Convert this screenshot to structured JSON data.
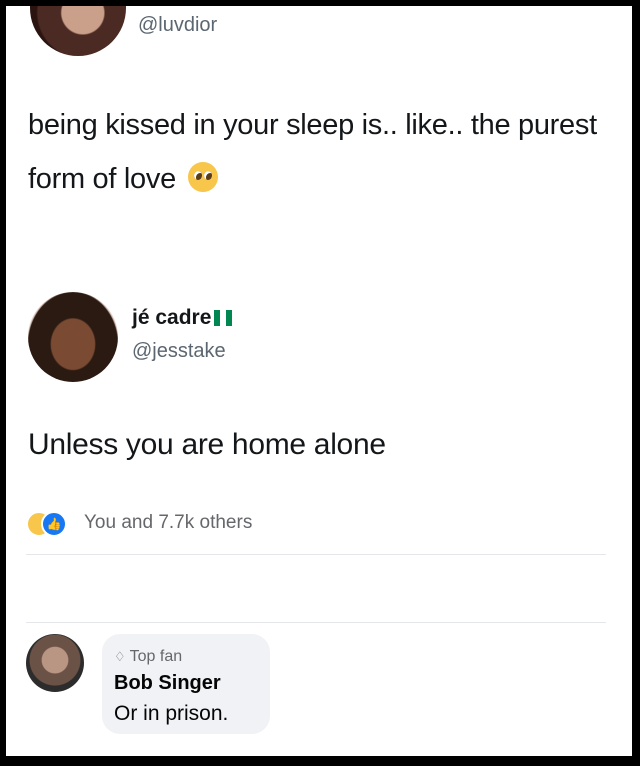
{
  "tweet_original": {
    "handle": "@luvdior",
    "text": "being kissed in your sleep is.. like.. the purest form of love",
    "emoji": "pleading-face-emoji"
  },
  "tweet_reply": {
    "display_name": "jé cadre",
    "flag": "nigeria-flag",
    "handle": "@jesstake",
    "text": "Unless you are home alone"
  },
  "reactions": {
    "icons": [
      "haha-reaction-icon",
      "like-reaction-icon"
    ],
    "summary": "You and 7.7k others"
  },
  "comment": {
    "badge": "Top fan",
    "author": "Bob Singer",
    "text": "Or in prison."
  }
}
